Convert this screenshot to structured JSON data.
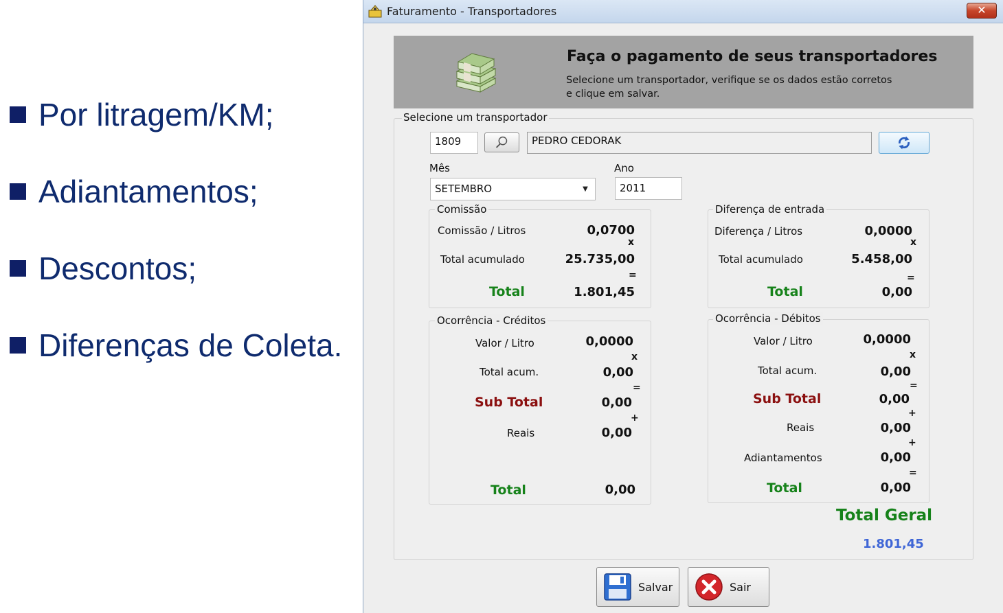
{
  "slide": {
    "bullets": [
      "Por litragem/KM;",
      "Adiantamentos;",
      "Descontos;",
      "Diferenças de Coleta."
    ]
  },
  "window": {
    "title": "Faturamento - Transportadores",
    "close_label": "✕"
  },
  "banner": {
    "title": "Faça o pagamento de seus transportadores",
    "subtitle_line1": "Selecione um transportador, verifique se os dados estão corretos",
    "subtitle_line2": "e clique em salvar."
  },
  "selector": {
    "legend": "Selecione um transportador",
    "code": "1809",
    "name": "PEDRO CEDORAK",
    "month_label": "Mês",
    "month_value": "SETEMBRO",
    "year_label": "Ano",
    "year_value": "2011"
  },
  "comissao": {
    "legend": "Comissão",
    "row1_label": "Comissão / Litros",
    "row1_value": "0,0700",
    "op1": "x",
    "row2_label": "Total acumulado",
    "row2_value": "25.735,00",
    "op2": "=",
    "total_label": "Total",
    "total_value": "1.801,45"
  },
  "diferenca": {
    "legend": "Diferença de entrada",
    "row1_label": "Diferença / Litros",
    "row1_value": "0,0000",
    "op1": "x",
    "row2_label": "Total acumulado",
    "row2_value": "5.458,00",
    "op2": "=",
    "total_label": "Total",
    "total_value": "0,00"
  },
  "creditos": {
    "legend": "Ocorrência - Créditos",
    "valor_label": "Valor / Litro",
    "valor_value": "0,0000",
    "op1": "x",
    "acum_label": "Total acum.",
    "acum_value": "0,00",
    "op2": "=",
    "subtotal_label": "Sub Total",
    "subtotal_value": "0,00",
    "op3": "+",
    "reais_label": "Reais",
    "reais_value": "0,00",
    "total_label": "Total",
    "total_value": "0,00"
  },
  "debitos": {
    "legend": "Ocorrência - Débitos",
    "valor_label": "Valor / Litro",
    "valor_value": "0,0000",
    "op1": "x",
    "acum_label": "Total acum.",
    "acum_value": "0,00",
    "op2": "=",
    "subtotal_label": "Sub Total",
    "subtotal_value": "0,00",
    "op3": "+",
    "reais_label": "Reais",
    "reais_value": "0,00",
    "op4": "+",
    "adiant_label": "Adiantamentos",
    "adiant_value": "0,00",
    "op5": "=",
    "total_label": "Total",
    "total_value": "0,00"
  },
  "total_geral": {
    "label": "Total Geral",
    "value": "1.801,45"
  },
  "buttons": {
    "save": "Salvar",
    "exit": "Sair"
  },
  "colors": {
    "green": "#16821a",
    "dark_red": "#8b1010",
    "blue_value": "#3f66d6",
    "bullet_blue": "#0f2b6e"
  }
}
